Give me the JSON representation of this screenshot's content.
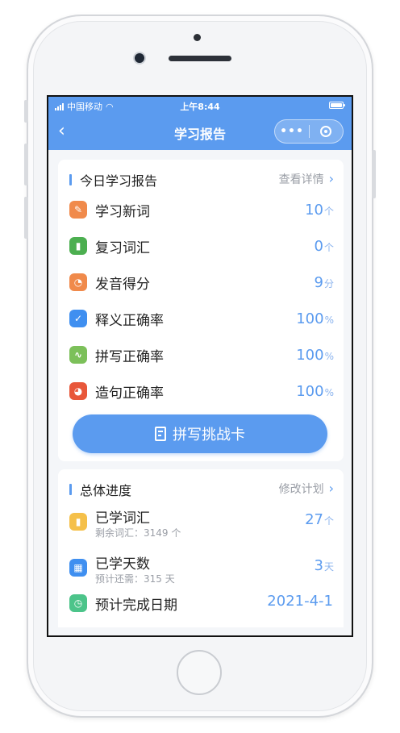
{
  "status": {
    "carrier": "中国移动",
    "time": "上午8:44"
  },
  "nav": {
    "back_icon": "chevron-left-icon",
    "title": "学习报告",
    "more_label": "•••"
  },
  "today": {
    "title": "今日学习报告",
    "link": "查看详情",
    "items": [
      {
        "label": "学习新词",
        "value": "10",
        "unit": "个",
        "icon": "pencil-icon",
        "color": "#f08a4b"
      },
      {
        "label": "复习词汇",
        "value": "0",
        "unit": "个",
        "icon": "book-icon",
        "color": "#4caf50"
      },
      {
        "label": "发音得分",
        "value": "9",
        "unit": "分",
        "icon": "pie-icon",
        "color": "#f08a4b"
      },
      {
        "label": "释义正确率",
        "value": "100",
        "unit": "%",
        "icon": "check-icon",
        "color": "#3f8ff0"
      },
      {
        "label": "拼写正确率",
        "value": "100",
        "unit": "%",
        "icon": "wave-icon",
        "color": "#7cc05a"
      },
      {
        "label": "造句正确率",
        "value": "100",
        "unit": "%",
        "icon": "pie-icon",
        "color": "#e8573a"
      }
    ],
    "cta": "拼写挑战卡"
  },
  "progress": {
    "title": "总体进度",
    "link": "修改计划",
    "items": [
      {
        "label": "已学词汇",
        "sub": "剩余词汇：3149 个",
        "value": "27",
        "unit": "个",
        "icon": "book-icon",
        "color": "#f5c04a"
      },
      {
        "label": "已学天数",
        "sub": "预计还需：315 天",
        "value": "3",
        "unit": "天",
        "icon": "calendar-icon",
        "color": "#3f8ff0"
      },
      {
        "label": "预计完成日期",
        "sub": "",
        "value": "2021-4-1",
        "unit": "",
        "icon": "clock-icon",
        "color": "#4cc48a"
      }
    ]
  },
  "colors": {
    "accent": "#5b9bef",
    "topbar": "#5b9bef"
  }
}
